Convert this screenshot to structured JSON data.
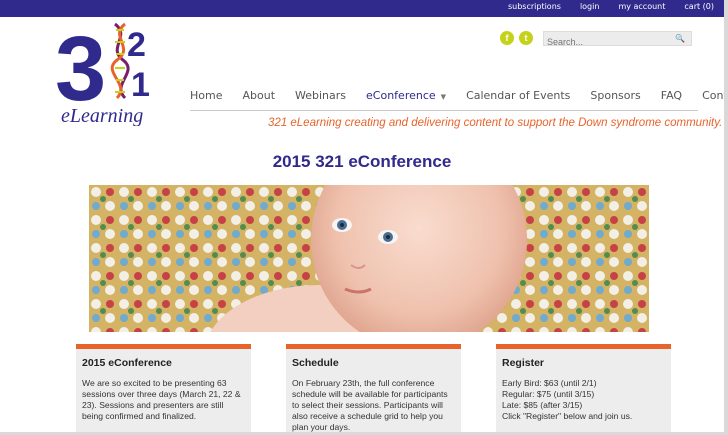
{
  "topbar": {
    "links": [
      "subscriptions",
      "login",
      "my account",
      "cart (0)"
    ]
  },
  "logo": {
    "digits": [
      "3",
      "2",
      "1"
    ],
    "wordmark": "eLearning"
  },
  "social": {
    "facebook": "f",
    "twitter": "t"
  },
  "search": {
    "placeholder": "Search...",
    "value": ""
  },
  "nav": {
    "items": [
      {
        "label": "Home"
      },
      {
        "label": "About"
      },
      {
        "label": "Webinars"
      },
      {
        "label": "eConference",
        "active": true
      },
      {
        "label": "Calendar of Events"
      },
      {
        "label": "Sponsors"
      },
      {
        "label": "FAQ"
      },
      {
        "label": "Contact Us"
      }
    ]
  },
  "tagline": "321 eLearning creating and delivering content to support the Down syndrome community.",
  "page_title": "2015 321 eConference",
  "columns": [
    {
      "title": "2015 eConference",
      "body": "We are so excited to be presenting 63 sessions over three days (March 21, 22 & 23). Sessions and presenters are still being confirmed and finalized."
    },
    {
      "title": "Schedule",
      "body": "On February 23th, the full conference schedule will be available for participants to select their sessions. Participants will also receive a schedule grid to help you plan your days."
    },
    {
      "title": "Register",
      "lines": [
        "Early Bird: $63 (until 2/1)",
        "Regular: $75 (until 3/15)",
        "Late: $85 (after 3/15)",
        "Click \"Register\" below and join us."
      ]
    }
  ],
  "colors": {
    "brand_purple": "#2f2a8c",
    "accent_orange": "#e8632b",
    "social_green": "#c4d31a"
  }
}
